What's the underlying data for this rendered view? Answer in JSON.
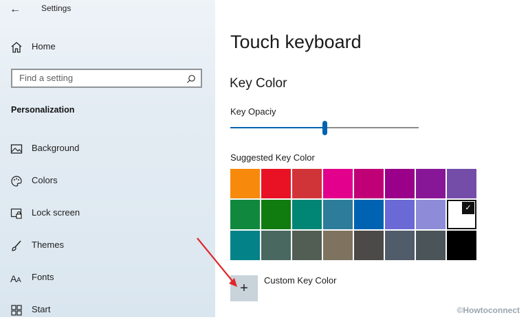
{
  "window": {
    "title": "Settings"
  },
  "search": {
    "placeholder": "Find a setting"
  },
  "sidebar": {
    "home_label": "Home",
    "section_heading": "Personalization",
    "items": [
      {
        "label": "Background",
        "icon": "picture-icon"
      },
      {
        "label": "Colors",
        "icon": "palette-icon"
      },
      {
        "label": "Lock screen",
        "icon": "lock-screen-icon"
      },
      {
        "label": "Themes",
        "icon": "brush-icon"
      },
      {
        "label": "Fonts",
        "icon": "fonts-icon"
      },
      {
        "label": "Start",
        "icon": "start-icon"
      }
    ]
  },
  "main": {
    "title": "Touch keyboard",
    "subtitle": "Key Color",
    "opacity_label": "Key Opaciy",
    "opacity_value": 0.5,
    "suggested_label": "Suggested Key Color",
    "swatches": [
      [
        "#f7890d",
        "#e81224",
        "#d13438",
        "#e3008c",
        "#bf0077",
        "#9a0089",
        "#881798",
        "#744da9"
      ],
      [
        "#10893e",
        "#107c10",
        "#018574",
        "#2d7d9a",
        "#0063b1",
        "#6b69d6",
        "#8e8cd8",
        "#ffffff"
      ],
      [
        "#038387",
        "#486860",
        "#525e54",
        "#7e735f",
        "#4c4a48",
        "#515c6b",
        "#4a5459",
        "#000000"
      ]
    ],
    "selected_swatch": "1-7",
    "custom_label": "Custom Key Color",
    "accent": "#0063b1"
  },
  "watermark": "©Howtoconnect"
}
